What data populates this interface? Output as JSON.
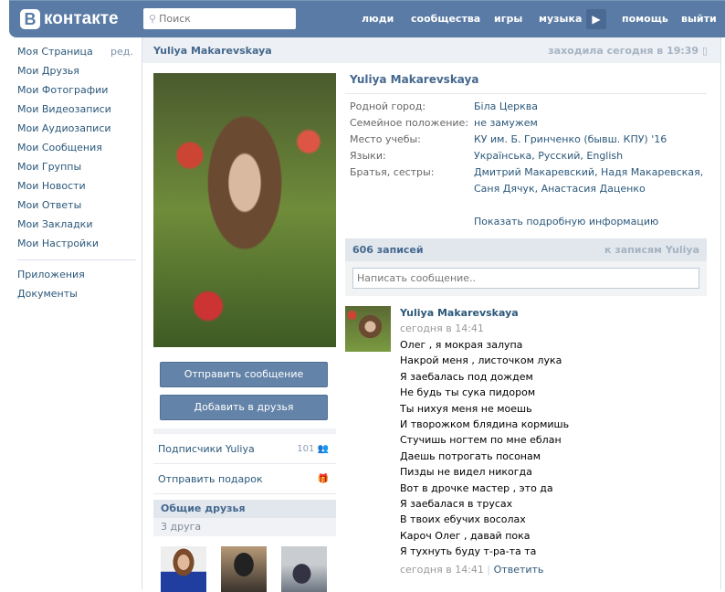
{
  "header": {
    "logo_letter": "В",
    "logo_text": "контакте",
    "search_placeholder": "Поиск",
    "nav": [
      "люди",
      "сообщества",
      "игры",
      "музыка",
      "помощь",
      "выйти"
    ]
  },
  "leftnav": {
    "edit": "ред.",
    "items": [
      "Моя Страница",
      "Мои Друзья",
      "Мои Фотографии",
      "Мои Видеозаписи",
      "Мои Аудиозаписи",
      "Мои Сообщения",
      "Мои Группы",
      "Мои Новости",
      "Мои Ответы",
      "Мои Закладки",
      "Мои Настройки"
    ],
    "extra": [
      "Приложения",
      "Документы"
    ]
  },
  "profile": {
    "name": "Yuliya Makarevskaya",
    "last_seen": "заходила сегодня в 19:39",
    "send_message": "Отправить сообщение",
    "add_friend": "Добавить в друзья",
    "followers_label": "Подписчики Yuliya",
    "followers_count": "101",
    "gift": "Отправить подарок",
    "common_friends": "Общие друзья",
    "common_count": "3 друга",
    "info": [
      {
        "k": "Родной город:",
        "v": "Біла Церква"
      },
      {
        "k": "Семейное положение:",
        "v": "не замужем"
      },
      {
        "k": "Место учебы:",
        "v": "КУ им. Б. Гринченко (бывш. КПУ) '16"
      },
      {
        "k": "Языки:",
        "v": "Українська, Русский, English"
      },
      {
        "k": "Братья, сестры:",
        "v": "Дмитрий Макаревский, Надя Макаревская, Саня Дячук, Анастасия Даценко"
      }
    ],
    "show_more": "Показать подробную информацию"
  },
  "wall": {
    "count": "606 записей",
    "to_posts": "к записям Yuliya",
    "placeholder": "Написать сообщение..",
    "post": {
      "author": "Yuliya Makarevskaya",
      "time": "сегодня в 14:41",
      "lines": [
        "Олег , я мокрая залупа",
        "Накрой меня , листочком лука",
        "Я заебалась под дождем",
        "Не будь ты сука пидором",
        "Ты нихуя меня не моешь",
        "И творожком блядина кормишь",
        "Стучишь ногтем по мне еблан",
        "Даешь потрогать посонам",
        "Пизды не видел никогда",
        "Вот в дрочке мастер , это да",
        "Я заебалася в трусах",
        "В твоих ебучих восолах",
        "Кароч Олег , давай пока",
        "Я тухнуть буду т-ра-та та"
      ],
      "footer_time": "сегодня в 14:41",
      "reply": "Ответить"
    }
  }
}
